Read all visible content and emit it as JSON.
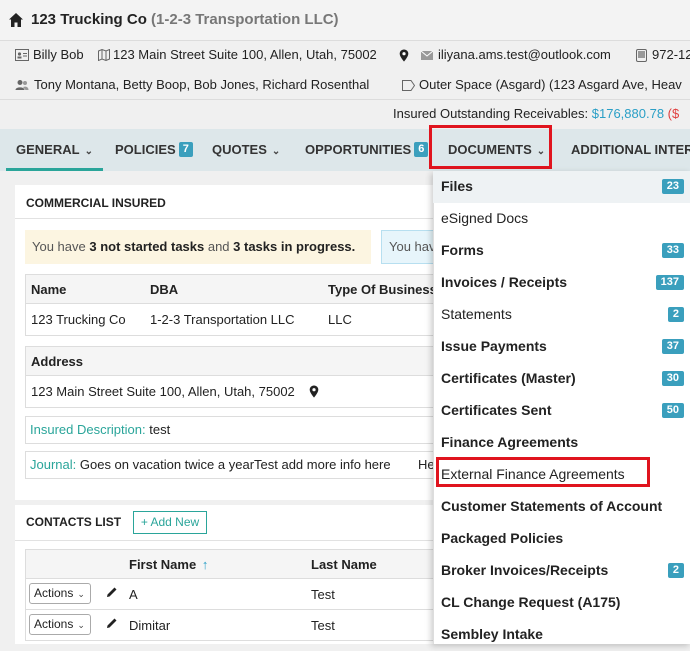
{
  "insured": {
    "name": "123 Trucking Co",
    "dba": "(1-2-3 Transportation LLC)",
    "contact": "Billy Bob",
    "address": "123 Main Street Suite 100, Allen, Utah, 75002",
    "email": "iliyana.ams.test@outlook.com",
    "phone": "972-12",
    "agents": "Tony Montana, Betty Boop, Bob Jones, Richard Rosenthal",
    "location": "Outer Space (Asgard) (123 Asgard Ave, Heav"
  },
  "receivables": {
    "label": "Insured Outstanding Receivables:",
    "amount": "$176,880.78",
    "trailing": "($"
  },
  "tabs": [
    {
      "label": "GENERAL",
      "badge": ""
    },
    {
      "label": "POLICIES",
      "badge": "7"
    },
    {
      "label": "QUOTES",
      "badge": ""
    },
    {
      "label": "OPPORTUNITIES",
      "badge": "6"
    },
    {
      "label": "DOCUMENTS",
      "badge": ""
    },
    {
      "label": "ADDITIONAL INTER",
      "badge": ""
    }
  ],
  "panel": {
    "title": "COMMERCIAL INSURED",
    "tasks_prefix": "You have ",
    "tasks_not_started": "3 not started tasks",
    "tasks_and": " and ",
    "tasks_in_progress": "3 tasks in progress.",
    "tasks2": "You hav",
    "columns": [
      "Name",
      "DBA",
      "Type Of Business"
    ],
    "row": [
      "123 Trucking Co",
      "1-2-3 Transportation LLC",
      "LLC"
    ],
    "address_label": "Address",
    "address_value": "123 Main Street Suite 100, Allen, Utah, 75002",
    "desc_label": "Insured Description:",
    "desc_value": "test",
    "journal_label": "Journal:",
    "journal_value": "Goes on vacation twice a yearTest add more info here",
    "journal_trailing": "He"
  },
  "contacts": {
    "title": "CONTACTS LIST",
    "add_new": "+ Add New",
    "columns": [
      "First Name",
      "Last Name"
    ],
    "actions_label": "Actions",
    "rows": [
      {
        "first": "A",
        "last": "Test"
      },
      {
        "first": "Dimitar",
        "last": "Test"
      }
    ]
  },
  "documents_menu": [
    {
      "label": "Files",
      "count": "23",
      "bold": true
    },
    {
      "label": "eSigned Docs",
      "count": "",
      "bold": false
    },
    {
      "label": "Forms",
      "count": "33",
      "bold": true
    },
    {
      "label": "Invoices / Receipts",
      "count": "137",
      "bold": true
    },
    {
      "label": "Statements",
      "count": "2",
      "bold": false
    },
    {
      "label": "Issue Payments",
      "count": "37",
      "bold": true
    },
    {
      "label": "Certificates (Master)",
      "count": "30",
      "bold": true
    },
    {
      "label": "Certificates Sent",
      "count": "50",
      "bold": true
    },
    {
      "label": "Finance Agreements",
      "count": "",
      "bold": true
    },
    {
      "label": "External Finance Agreements",
      "count": "",
      "bold": false
    },
    {
      "label": "Customer Statements of Account",
      "count": "",
      "bold": true
    },
    {
      "label": "Packaged Policies",
      "count": "",
      "bold": true
    },
    {
      "label": "Broker Invoices/Receipts",
      "count": "2",
      "bold": true
    },
    {
      "label": "CL Change Request (A175)",
      "count": "",
      "bold": true
    },
    {
      "label": "Sembley Intake",
      "count": "",
      "bold": true
    }
  ],
  "colors": {
    "accent": "#2aa59a",
    "badge": "#3a9fbd",
    "highlight": "#e0141e",
    "amount": "#2a9fc6"
  }
}
